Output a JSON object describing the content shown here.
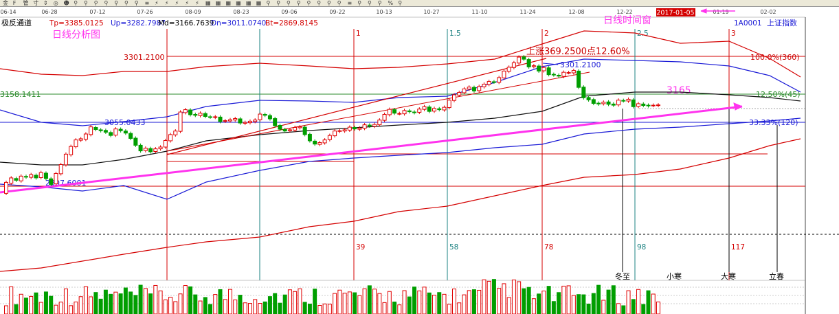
{
  "toolbar": {
    "icons": [
      "金",
      "F",
      "管",
      "寸",
      "⇕",
      "◎",
      "☻",
      "⚲",
      "⚲",
      "⚲",
      "⚲",
      "⚲",
      "⚲",
      "⚲",
      "≡",
      "⚡",
      "⚡",
      "⚡",
      "⚡",
      "⚡",
      "▦",
      "▦",
      "▦",
      "▦",
      "▦",
      "▦",
      "⚲",
      "⚲",
      "⚲",
      "⚲",
      "⚲",
      "⚲",
      "⚲",
      "⚲",
      "≡",
      "⚲",
      "⚲",
      "⚲",
      "%",
      "⚲"
    ],
    "dates": [
      "06-14",
      "06-28",
      "07-12",
      "07-26",
      "08-09",
      "08-23",
      "09-06",
      "09-22",
      "10-13",
      "10-27",
      "11-10",
      "11-24",
      "12-08",
      "12-22",
      "01-19",
      "02-02"
    ],
    "highlight_date": "2017-01-05"
  },
  "header": {
    "indicator": "极反通道",
    "tp": "Tp=3385.0125",
    "up": "Up=3282.7987",
    "md": "Md=3166.7639",
    "dn": "Dn=3011.0740",
    "bt": "Bt=2869.8145",
    "code": "1A0001",
    "name": "上证指数"
  },
  "annotations": {
    "daily_analysis": "日线分析图",
    "daily_time_window": "日线时间窗",
    "level_3165": "3165",
    "rise_label": "上涨369.2500点12.60%",
    "high_label": "3301.2100",
    "mid_high_label": "3301.2100",
    "h_3301": "3301.2100",
    "h_3158": "3158.1411",
    "h_3055": "3055.0433",
    "h_2807": "2807.6001",
    "pct_100": "100.0%(360)",
    "pct_1250": "12.50%(45)",
    "pct_3333": "33.33%(120)"
  },
  "time_lines": {
    "top_labels": [
      "1",
      "1.5",
      "2",
      "2.5",
      "3"
    ],
    "bottom_labels": [
      "39",
      "58",
      "78",
      "98",
      "117"
    ]
  },
  "solar_terms": [
    "冬至",
    "小寒",
    "大寒",
    "立春"
  ],
  "colors": {
    "up": "#e00000",
    "down": "#009e00",
    "magenta": "#ff33ee",
    "blue": "#1a1ad6",
    "red_band": "#d40000",
    "teal": "#1a8080",
    "hline_red": "#d40000",
    "hline_green": "#2a8a2a",
    "hline_blue": "#1a1ad6",
    "label_red": "#cc0000"
  },
  "chart_data": {
    "type": "candlestick",
    "title": "上证指数",
    "ylim": [
      2700,
      3420
    ],
    "x": [
      "06-14",
      "06-28",
      "07-12",
      "07-26",
      "08-09",
      "08-23",
      "09-06",
      "09-22",
      "10-13",
      "10-27",
      "11-10",
      "11-24",
      "12-08",
      "12-22",
      "01-19",
      "02-02"
    ],
    "levels": [
      3301.21,
      3158.1411,
      3055.0433,
      2807.6001
    ],
    "candles": [
      {
        "o": 2838,
        "c": 2875
      },
      {
        "o": 2872,
        "c": 2890
      },
      {
        "o": 2888,
        "c": 2882
      },
      {
        "o": 2880,
        "c": 2896
      },
      {
        "o": 2895,
        "c": 2893
      },
      {
        "o": 2892,
        "c": 2901
      },
      {
        "o": 2899,
        "c": 2890
      },
      {
        "o": 2891,
        "c": 2908
      },
      {
        "o": 2906,
        "c": 2888
      },
      {
        "o": 2887,
        "c": 2868
      },
      {
        "o": 2870,
        "c": 2905
      },
      {
        "o": 2904,
        "c": 2935
      },
      {
        "o": 2934,
        "c": 2970
      },
      {
        "o": 2968,
        "c": 2996
      },
      {
        "o": 2995,
        "c": 3018
      },
      {
        "o": 3017,
        "c": 3022
      },
      {
        "o": 3020,
        "c": 3038
      },
      {
        "o": 3036,
        "c": 3062
      },
      {
        "o": 3060,
        "c": 3053
      },
      {
        "o": 3052,
        "c": 3049
      },
      {
        "o": 3050,
        "c": 3044
      },
      {
        "o": 3043,
        "c": 3033
      },
      {
        "o": 3034,
        "c": 3055
      },
      {
        "o": 3054,
        "c": 3049
      },
      {
        "o": 3048,
        "c": 3041
      },
      {
        "o": 3040,
        "c": 3023
      },
      {
        "o": 3024,
        "c": 3000
      },
      {
        "o": 3000,
        "c": 2981
      },
      {
        "o": 2982,
        "c": 2990
      },
      {
        "o": 2989,
        "c": 2978
      },
      {
        "o": 2979,
        "c": 2988
      },
      {
        "o": 2988,
        "c": 2994
      },
      {
        "o": 2994,
        "c": 3016
      },
      {
        "o": 3015,
        "c": 3036
      },
      {
        "o": 3035,
        "c": 3048
      },
      {
        "o": 3047,
        "c": 3112
      },
      {
        "o": 3110,
        "c": 3120
      },
      {
        "o": 3119,
        "c": 3103
      },
      {
        "o": 3104,
        "c": 3101
      },
      {
        "o": 3100,
        "c": 3108
      },
      {
        "o": 3107,
        "c": 3097
      },
      {
        "o": 3096,
        "c": 3095
      },
      {
        "o": 3094,
        "c": 3096
      },
      {
        "o": 3095,
        "c": 3080
      },
      {
        "o": 3081,
        "c": 3083
      },
      {
        "o": 3082,
        "c": 3086
      },
      {
        "o": 3085,
        "c": 3090
      },
      {
        "o": 3089,
        "c": 3075
      },
      {
        "o": 3074,
        "c": 3077
      },
      {
        "o": 3076,
        "c": 3081
      },
      {
        "o": 3080,
        "c": 3085
      },
      {
        "o": 3086,
        "c": 3105
      },
      {
        "o": 3104,
        "c": 3101
      },
      {
        "o": 3100,
        "c": 3089
      },
      {
        "o": 3090,
        "c": 3066
      },
      {
        "o": 3067,
        "c": 3054
      },
      {
        "o": 3053,
        "c": 3048
      },
      {
        "o": 3049,
        "c": 3052
      },
      {
        "o": 3051,
        "c": 3060
      },
      {
        "o": 3059,
        "c": 3062
      },
      {
        "o": 3061,
        "c": 3036
      },
      {
        "o": 3037,
        "c": 3015
      },
      {
        "o": 3014,
        "c": 3004
      },
      {
        "o": 3003,
        "c": 3009
      },
      {
        "o": 3008,
        "c": 3018
      },
      {
        "o": 3019,
        "c": 3033
      },
      {
        "o": 3032,
        "c": 3048
      },
      {
        "o": 3047,
        "c": 3049
      },
      {
        "o": 3048,
        "c": 3052
      },
      {
        "o": 3051,
        "c": 3061
      },
      {
        "o": 3060,
        "c": 3055
      },
      {
        "o": 3054,
        "c": 3058
      },
      {
        "o": 3057,
        "c": 3069
      },
      {
        "o": 3068,
        "c": 3065
      },
      {
        "o": 3064,
        "c": 3070
      },
      {
        "o": 3069,
        "c": 3085
      },
      {
        "o": 3084,
        "c": 3104
      },
      {
        "o": 3103,
        "c": 3121
      },
      {
        "o": 3120,
        "c": 3108
      },
      {
        "o": 3107,
        "c": 3107
      },
      {
        "o": 3106,
        "c": 3117
      },
      {
        "o": 3116,
        "c": 3113
      },
      {
        "o": 3112,
        "c": 3110
      },
      {
        "o": 3111,
        "c": 3122
      },
      {
        "o": 3121,
        "c": 3130
      },
      {
        "o": 3129,
        "c": 3114
      },
      {
        "o": 3115,
        "c": 3124
      },
      {
        "o": 3123,
        "c": 3120
      },
      {
        "o": 3119,
        "c": 3128
      },
      {
        "o": 3127,
        "c": 3152
      },
      {
        "o": 3151,
        "c": 3170
      },
      {
        "o": 3169,
        "c": 3178
      },
      {
        "o": 3177,
        "c": 3190
      },
      {
        "o": 3189,
        "c": 3196
      },
      {
        "o": 3195,
        "c": 3183
      },
      {
        "o": 3184,
        "c": 3198
      },
      {
        "o": 3197,
        "c": 3206
      },
      {
        "o": 3205,
        "c": 3215
      },
      {
        "o": 3214,
        "c": 3213
      },
      {
        "o": 3212,
        "c": 3228
      },
      {
        "o": 3227,
        "c": 3250
      },
      {
        "o": 3249,
        "c": 3263
      },
      {
        "o": 3262,
        "c": 3278
      },
      {
        "o": 3277,
        "c": 3297
      },
      {
        "o": 3298,
        "c": 3290
      },
      {
        "o": 3289,
        "c": 3264
      },
      {
        "o": 3265,
        "c": 3268
      },
      {
        "o": 3267,
        "c": 3250
      },
      {
        "o": 3251,
        "c": 3262
      },
      {
        "o": 3261,
        "c": 3238
      },
      {
        "o": 3239,
        "c": 3237
      },
      {
        "o": 3236,
        "c": 3233
      },
      {
        "o": 3232,
        "c": 3246
      },
      {
        "o": 3245,
        "c": 3245
      },
      {
        "o": 3244,
        "c": 3252
      },
      {
        "o": 3250,
        "c": 3195
      },
      {
        "o": 3196,
        "c": 3160
      },
      {
        "o": 3161,
        "c": 3153
      },
      {
        "o": 3154,
        "c": 3141
      },
      {
        "o": 3142,
        "c": 3139
      },
      {
        "o": 3140,
        "c": 3145
      },
      {
        "o": 3146,
        "c": 3138
      },
      {
        "o": 3139,
        "c": 3135
      },
      {
        "o": 3136,
        "c": 3152
      },
      {
        "o": 3151,
        "c": 3150
      },
      {
        "o": 3149,
        "c": 3155
      },
      {
        "o": 3153,
        "c": 3130
      },
      {
        "o": 3131,
        "c": 3140
      },
      {
        "o": 3139,
        "c": 3134
      },
      {
        "o": 3135,
        "c": 3133
      },
      {
        "o": 3134,
        "c": 3135
      },
      {
        "o": 3134,
        "c": 3136
      }
    ]
  }
}
